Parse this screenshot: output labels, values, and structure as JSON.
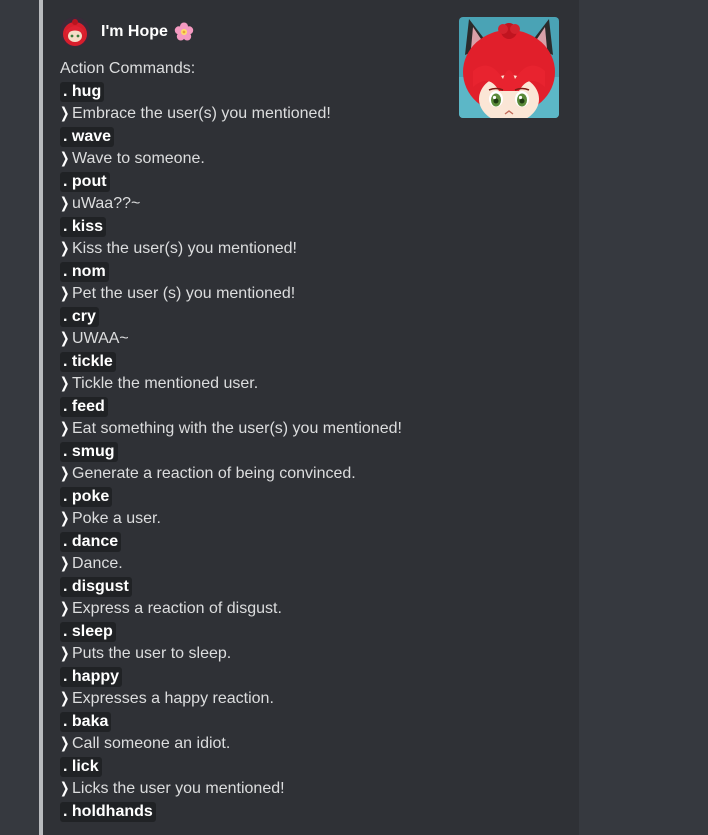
{
  "author": {
    "name": "I'm Hope",
    "avatar_icon": "anime-girl-avatar-icon",
    "badge_icon": "flower-emoji-icon"
  },
  "heading": "Action Commands:",
  "prefix": ".",
  "chevron": "❯",
  "commands": [
    {
      "name": "hug",
      "desc": "Embrace the user(s) you mentioned!"
    },
    {
      "name": "wave",
      "desc": "Wave to someone."
    },
    {
      "name": "pout",
      "desc": "uWaa??~"
    },
    {
      "name": "kiss",
      "desc": "Kiss the user(s) you mentioned!"
    },
    {
      "name": "nom",
      "desc": "Pet the user (s) you mentioned!"
    },
    {
      "name": "cry",
      "desc": "UWAA~"
    },
    {
      "name": "tickle",
      "desc": "Tickle the mentioned user."
    },
    {
      "name": "feed",
      "desc": "Eat something with the user(s) you mentioned!"
    },
    {
      "name": "smug",
      "desc": "Generate a reaction of being convinced."
    },
    {
      "name": "poke",
      "desc": "Poke a user."
    },
    {
      "name": "dance",
      "desc": "Dance."
    },
    {
      "name": "disgust",
      "desc": "Express a reaction of disgust."
    },
    {
      "name": "sleep",
      "desc": "Puts the user to sleep."
    },
    {
      "name": "happy",
      "desc": "Expresses a happy reaction."
    },
    {
      "name": "baka",
      "desc": "Call someone an idiot."
    },
    {
      "name": "lick",
      "desc": "Licks the user you mentioned!"
    },
    {
      "name": "holdhands",
      "desc": ""
    }
  ],
  "colors": {
    "background": "#36393f",
    "embed": "#2f3136",
    "embed_border": "#b9bbbe",
    "code_bg": "#202225",
    "text": "#dcddde"
  }
}
